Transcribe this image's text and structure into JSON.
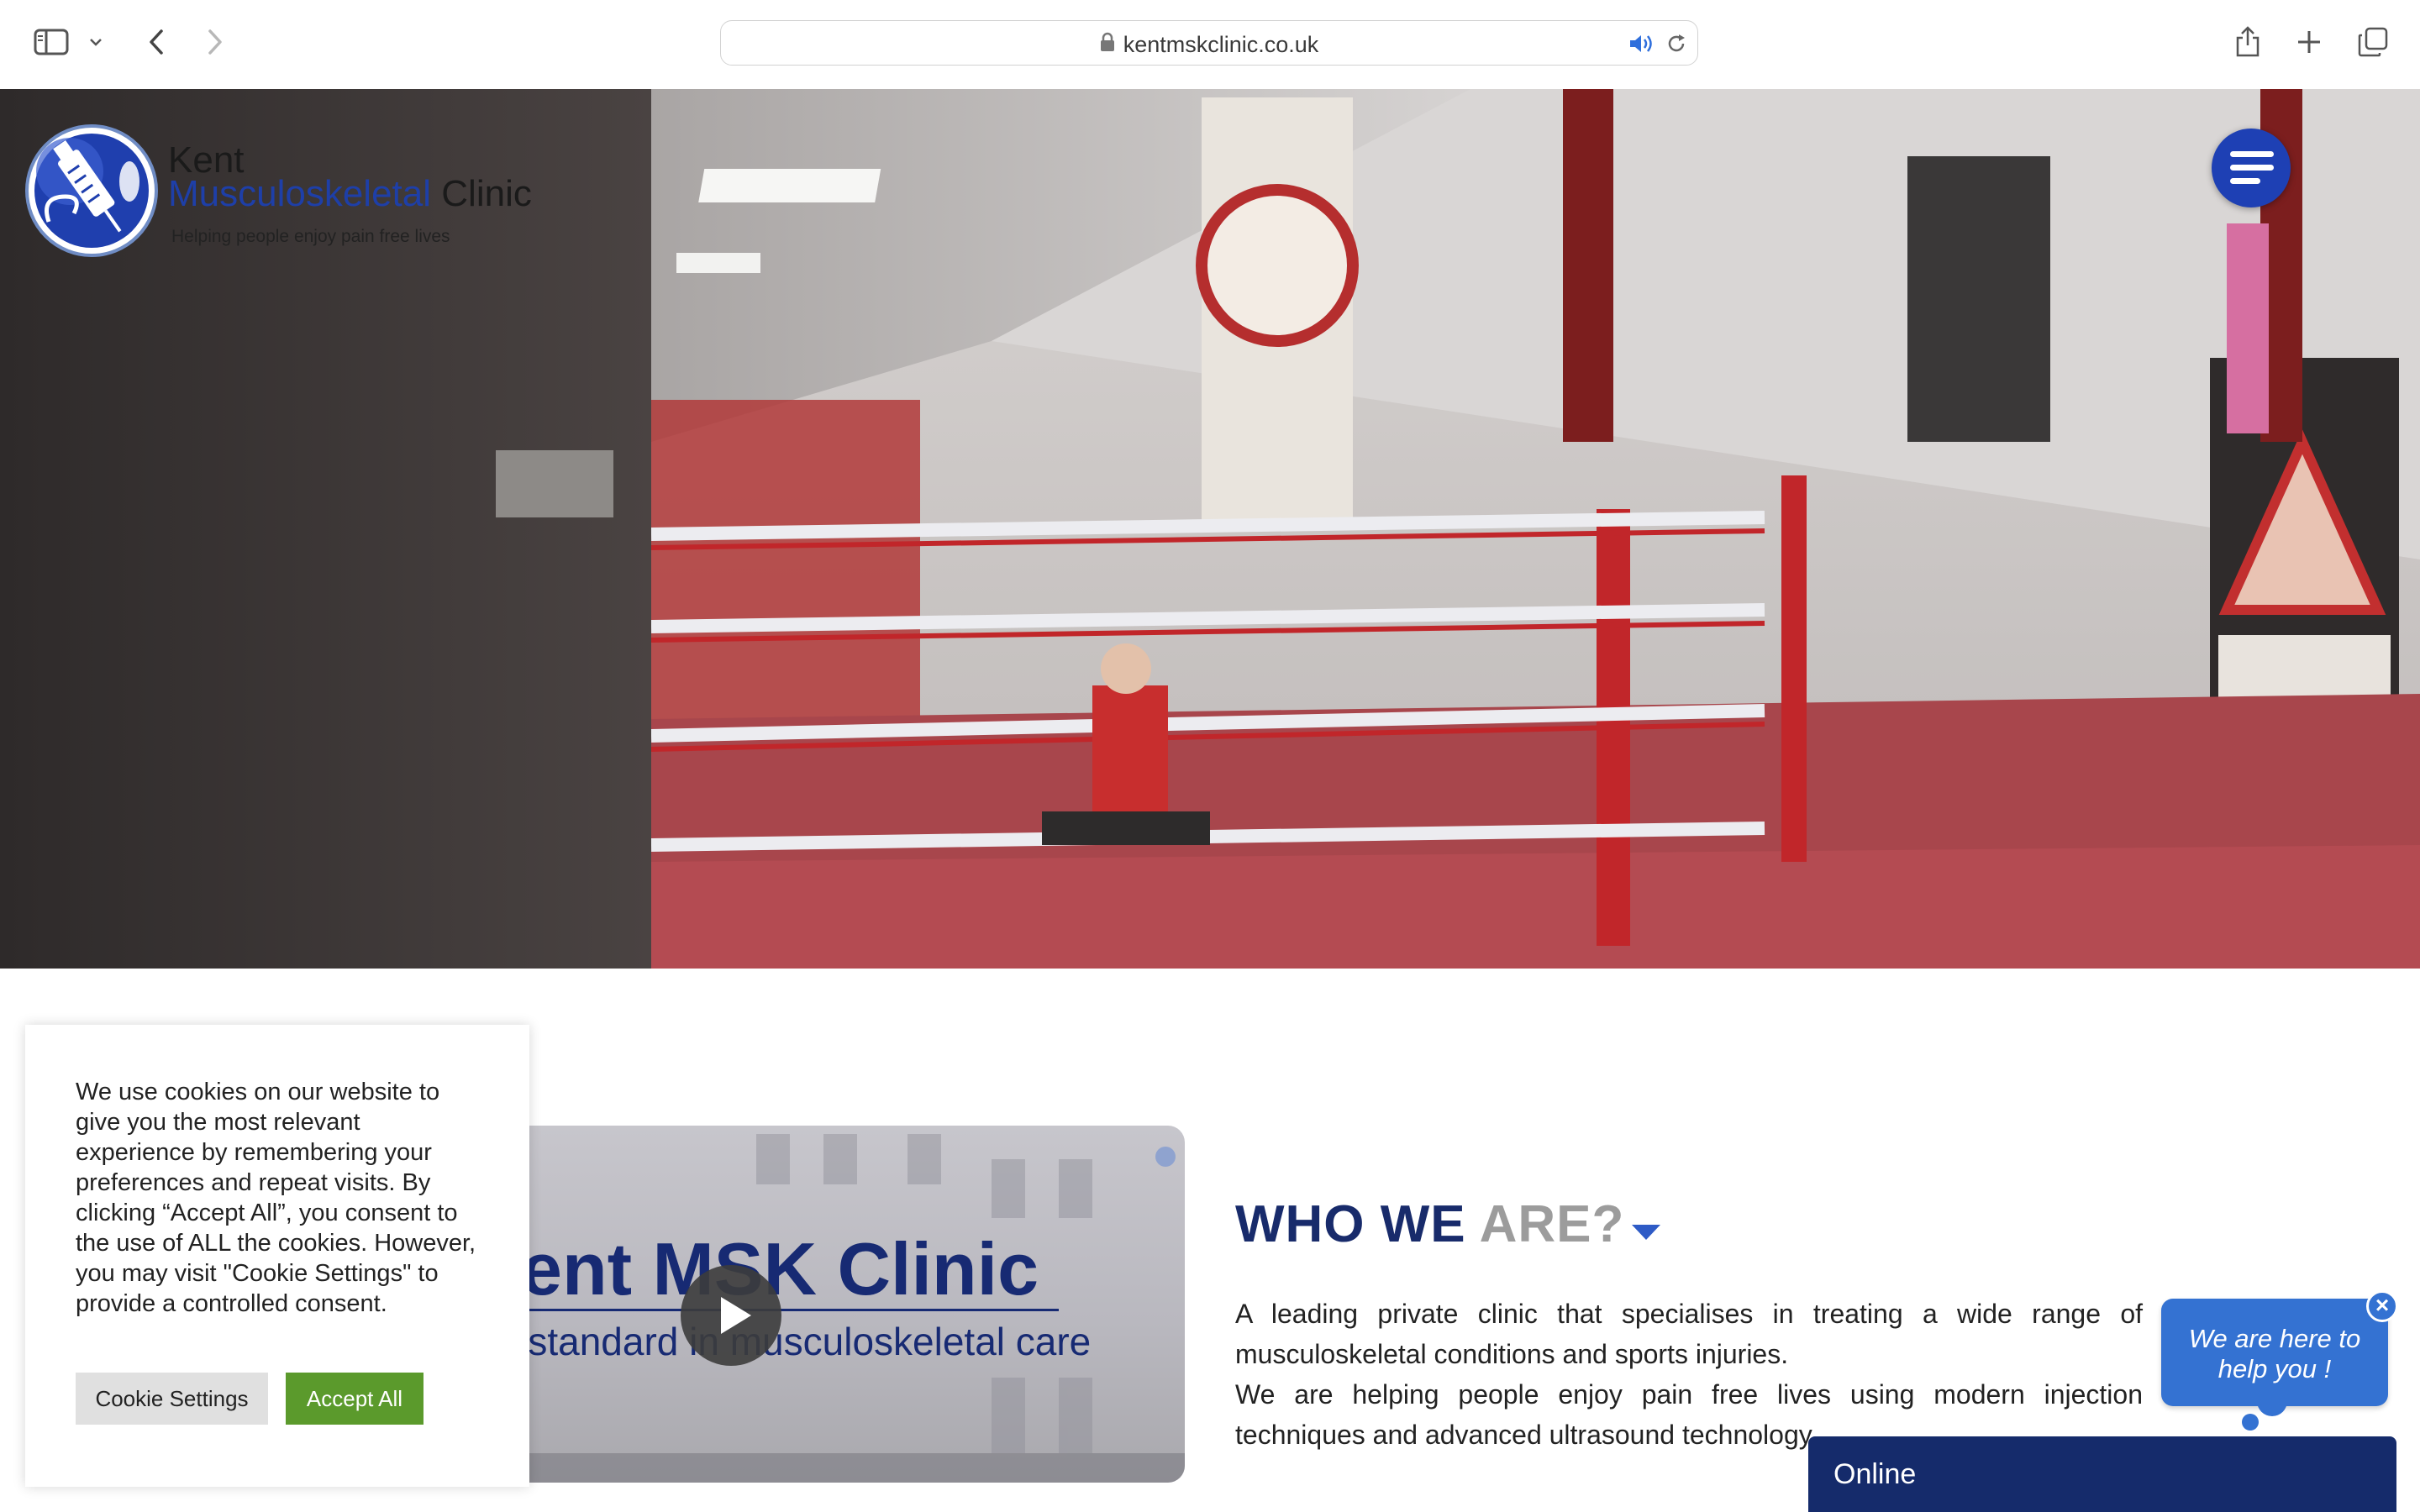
{
  "browser": {
    "url": "kentmskclinic.co.uk",
    "icons": [
      "sidebar-icon",
      "chevron-down-icon",
      "back-icon",
      "forward-icon",
      "lock-icon",
      "speaker-icon",
      "reload-icon",
      "share-icon",
      "new-tab-icon",
      "tabs-overview-icon"
    ]
  },
  "logo": {
    "line1": "Kent",
    "line2_blue": "Musculoskeletal",
    "line2_dark": "Clinic",
    "tagline": "Helping people enjoy pain free lives"
  },
  "cookie": {
    "text": "We use cookies on our website to give you the most relevant experience by remembering your preferences and repeat visits. By clicking “Accept All”, you consent to the use of ALL the cookies. However, you may visit \"Cookie Settings\" to provide a controlled consent.",
    "settings_label": "Cookie Settings",
    "accept_label": "Accept All"
  },
  "video": {
    "title": "ent MSK Clinic",
    "subtitle": "e standard in musculoskeletal care"
  },
  "who": {
    "title_dark": "WHO WE",
    "title_grey": "ARE?",
    "paragraph1": "A leading private clinic that specialises in treating a wide range of musculoskeletal conditions and sports injuries.",
    "paragraph2": "We are helping people enjoy pain free lives using modern injection techniques and advanced ultrasound technology."
  },
  "chat": {
    "bubble_text": "We are here to help you !",
    "status": "Online"
  },
  "colors": {
    "brand_blue": "#1e40b4",
    "heading_navy": "#182b6b",
    "accept_green": "#5b9a2c",
    "chat_blue": "#3472d2"
  }
}
